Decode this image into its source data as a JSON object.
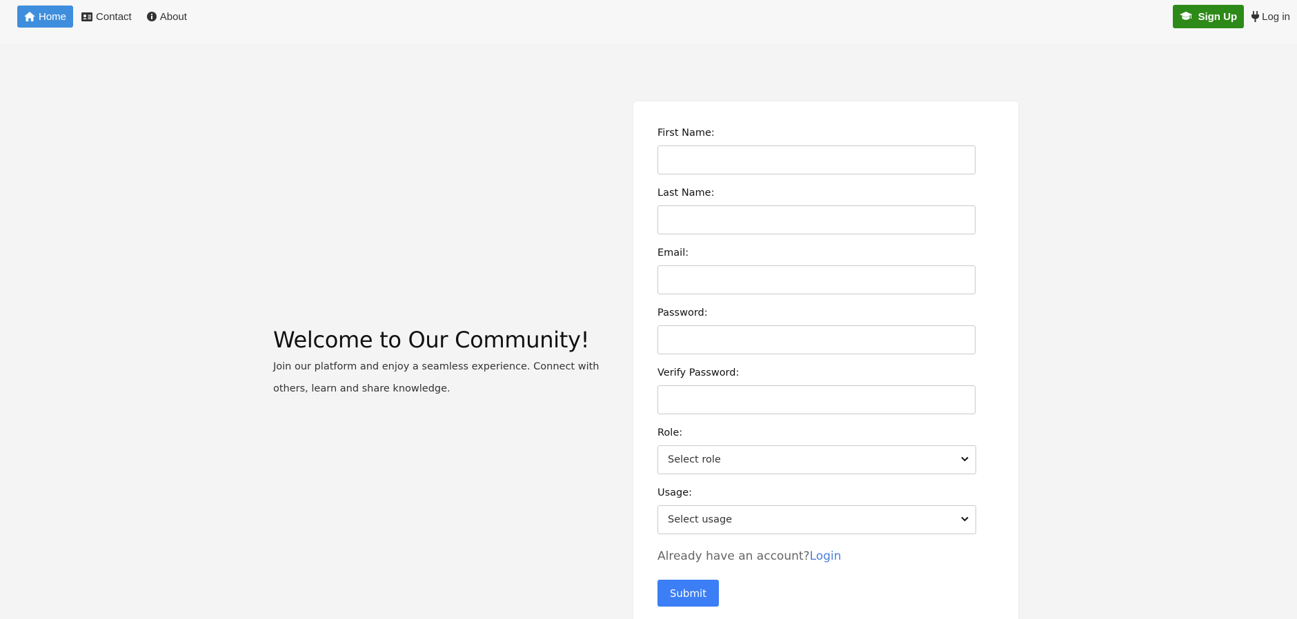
{
  "nav": {
    "home": "Home",
    "contact": "Contact",
    "about": "About",
    "signup": "Sign Up",
    "login": "Log in"
  },
  "hero": {
    "title": "Welcome to Our Community!",
    "description": "Join our platform and enjoy a seamless experience. Connect with others, learn and share knowledge."
  },
  "form": {
    "first_name_label": "First Name:",
    "first_name_value": "",
    "last_name_label": "Last Name:",
    "last_name_value": "",
    "email_label": "Email:",
    "email_value": "",
    "password_label": "Password:",
    "password_value": "",
    "verify_password_label": "Verify Password:",
    "verify_password_value": "",
    "role_label": "Role:",
    "role_selected": "Select role",
    "usage_label": "Usage:",
    "usage_selected": "Select usage",
    "account_prompt": "Already have an account?",
    "login_link": "Login",
    "submit_label": "Submit"
  },
  "icons": {
    "home": "home-icon",
    "contact": "id-card-icon",
    "about": "info-icon",
    "signup": "graduation-cap-icon",
    "login": "plug-icon",
    "select": "chevron-down-icon"
  },
  "colors": {
    "home_active": "#3f8edd",
    "signup": "#2e8a18",
    "submit": "#3b7ef5",
    "link": "#4c7fd9"
  }
}
